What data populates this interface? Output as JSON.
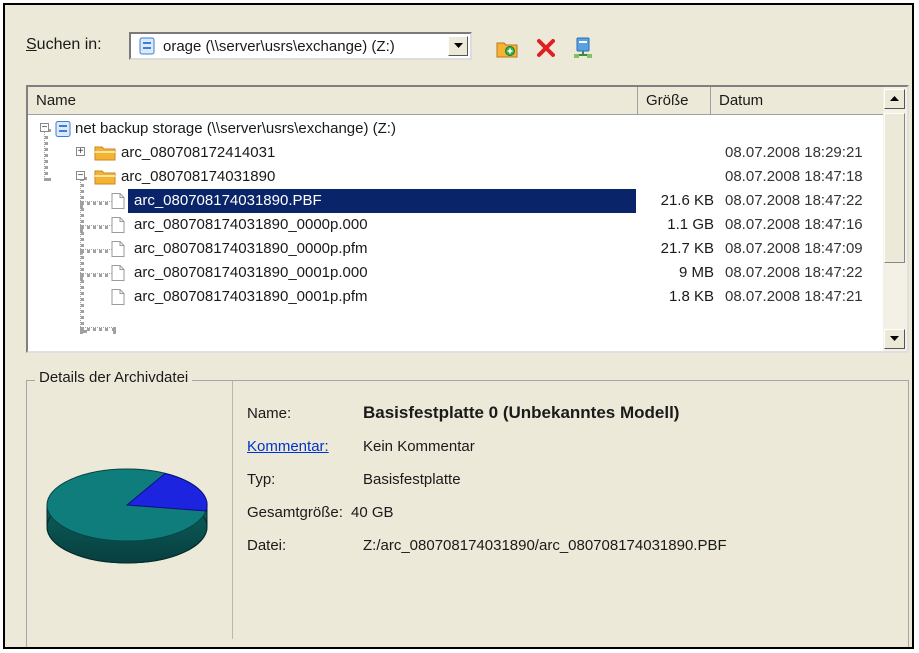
{
  "toolbar": {
    "lookin_accel": "S",
    "lookin_rest": "uchen in:",
    "location_value": "orage (\\\\server\\usrs\\exchange) (Z:)",
    "icons": [
      "new-folder-icon",
      "delete-icon",
      "network-drive-icon"
    ]
  },
  "list": {
    "columns": [
      "Name",
      "Größe",
      "Datum"
    ],
    "rows": [
      {
        "name": "net backup storage (\\\\server\\usrs\\exchange) (Z:)",
        "size": "",
        "date": "",
        "icon": "drive-icon"
      },
      {
        "name": "arc_080708172414031",
        "size": "",
        "date": "08.07.2008 18:29:21",
        "icon": "folder-icon"
      },
      {
        "name": "arc_080708174031890",
        "size": "",
        "date": "08.07.2008 18:47:18",
        "icon": "folder-icon"
      },
      {
        "name": "arc_080708174031890.PBF",
        "size": "21.6 KB",
        "date": "08.07.2008 18:47:22",
        "icon": "file-icon",
        "selected": true
      },
      {
        "name": "arc_080708174031890_0000p.000",
        "size": "1.1 GB",
        "date": "08.07.2008 18:47:16",
        "icon": "file-icon"
      },
      {
        "name": "arc_080708174031890_0000p.pfm",
        "size": "21.7 KB",
        "date": "08.07.2008 18:47:09",
        "icon": "file-icon"
      },
      {
        "name": "arc_080708174031890_0001p.000",
        "size": "9 MB",
        "date": "08.07.2008 18:47:22",
        "icon": "file-icon"
      },
      {
        "name": "arc_080708174031890_0001p.pfm",
        "size": "1.8 KB",
        "date": "08.07.2008 18:47:21",
        "icon": "file-icon"
      }
    ]
  },
  "details": {
    "legend": "Details der Archivdatei",
    "name_label": "Name:",
    "name_value": "Basisfestplatte 0 (Unbekanntes Modell)",
    "comment_label": "Kommentar:",
    "comment_value": "Kein Kommentar",
    "type_label": "Typ:",
    "type_value": "Basisfestplatte",
    "total_label": "Gesamtgröße:",
    "total_value": "40 GB",
    "file_label": "Datei:",
    "file_value": "Z:/arc_080708174031890/arc_080708174031890.PBF"
  },
  "colors": {
    "selection": "#0a246a",
    "pie_main": "#0f7d7b",
    "pie_slice": "#1d24e0",
    "link": "#0033cc"
  }
}
